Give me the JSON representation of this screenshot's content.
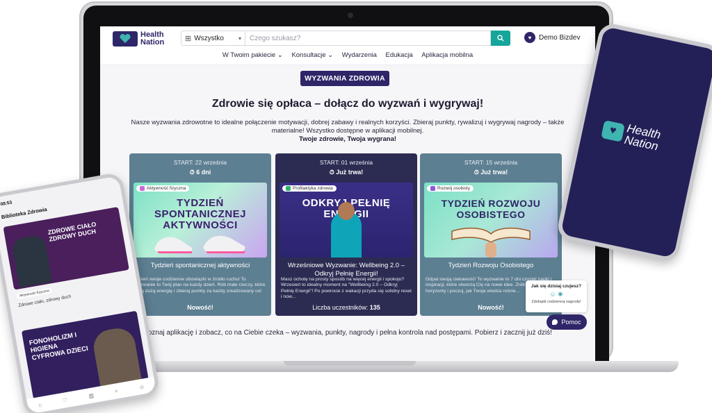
{
  "brand": {
    "name_line1": "Health",
    "name_line2": "Nation"
  },
  "search": {
    "category": "Wszystko",
    "placeholder": "Czego szukasz?"
  },
  "user": {
    "name": "Demo Bizdev"
  },
  "nav": [
    {
      "label": "W Twoim pakiecie ⌄"
    },
    {
      "label": "Konsultacje ⌄"
    },
    {
      "label": "Wydarzenia"
    },
    {
      "label": "Edukacja"
    },
    {
      "label": "Aplikacja mobilna"
    }
  ],
  "section_badge": "WYZWANIA ZDROWIA",
  "headline": "Zdrowie się opłaca – dołącz do wyzwań i wygrywaj!",
  "intro": "Nasze wyzwania zdrowotne to idealne połączenie motywacji, dobrej zabawy i realnych korzyści. Zbieraj punkty, rywalizuj i wygrywaj nagrody – także materialne! Wszystko dostępne w aplikacji mobilnej.",
  "intro_bold": "Twoje zdrowie, Twoja wygrana!",
  "cards": [
    {
      "start": "START: 22 września",
      "duration": "⏱ 6 dni",
      "tag": "Aktywność fizyczna",
      "image_title": "TYDZIEŃ SPONTANICZNEJ AKTYWNOŚCI",
      "title": "Tydzień spontanicznej aktywności",
      "desc": "Zmień swoje codzienne obowiązki w źródło ruchu! To wyzwanie to Twój plan na każdy dzień. Rób małe rzeczy, które dają dużą energię i zbieraj punkty za każdy zrealizowany cel z...",
      "footer": "Nowość!"
    },
    {
      "start": "START: 01 września",
      "duration": "⏱ Już trwa!",
      "tag": "Profilaktyka zdrowia",
      "image_title": "ODKRYJ PEŁNIĘ ENERGII",
      "title": "Wrześniowe Wyzwanie: Wellbeing 2.0 – Odkryj Pełnię Energii!",
      "desc": "Masz ochotę na prosty sposób na więcej energii i spokoju? Wrzesień to idealny moment na \"Wellbeing 2.0 – Odkryj Pełnię Energii\"! Po powrocie z wakacji przyda się solidny reset i now...",
      "footer_label": "Liczba uczestników:",
      "footer_value": "135"
    },
    {
      "start": "START: 15 września",
      "duration": "⏱ Już trwa!",
      "tag": "Rozwój osobisty",
      "image_title": "TYDZIEŃ ROZWOJU OSOBISTEGO",
      "title": "Tydzień Rozwoju Osobistego",
      "desc": "Odpal swoją ciekawość! To wyzwanie to 7 dni czystej nauki i inspiracji, które otworzą Cię na nowe idee. Zrób krok, poszerz horyzonty i poczuj, jak Twoja wiedza rośnie...",
      "footer": "Nowość!"
    }
  ],
  "bottom_line": "Poznaj aplikację i zobacz, co na Ciebie czeka – wyzwania, punkty, nagrody i pełna kontrola nad postępami. Pobierz i zacznij już dziś!",
  "mood": {
    "question": "Jak się dzisiaj czujesz?",
    "sub": "Zdobądź codzienną nagrodę!"
  },
  "help": "Pomoc",
  "phone_left": {
    "time": "08:53",
    "title": "Biblioteka Zdrowia",
    "card1_title": "ZDROWE CIAŁO ZDROWY DUCH",
    "card1_tag": "Aktywność fizyczna",
    "card1_sub": "Zdrowe ciało, zdrowy duch",
    "card2_title": "FONOHOLIZM I HIGIENA CYFROWA DZIECI"
  },
  "colors": {
    "brand": "#2e2668",
    "teal": "#15a59a",
    "card_slate": "#5d7f92",
    "card_navy": "#2c2c52"
  }
}
